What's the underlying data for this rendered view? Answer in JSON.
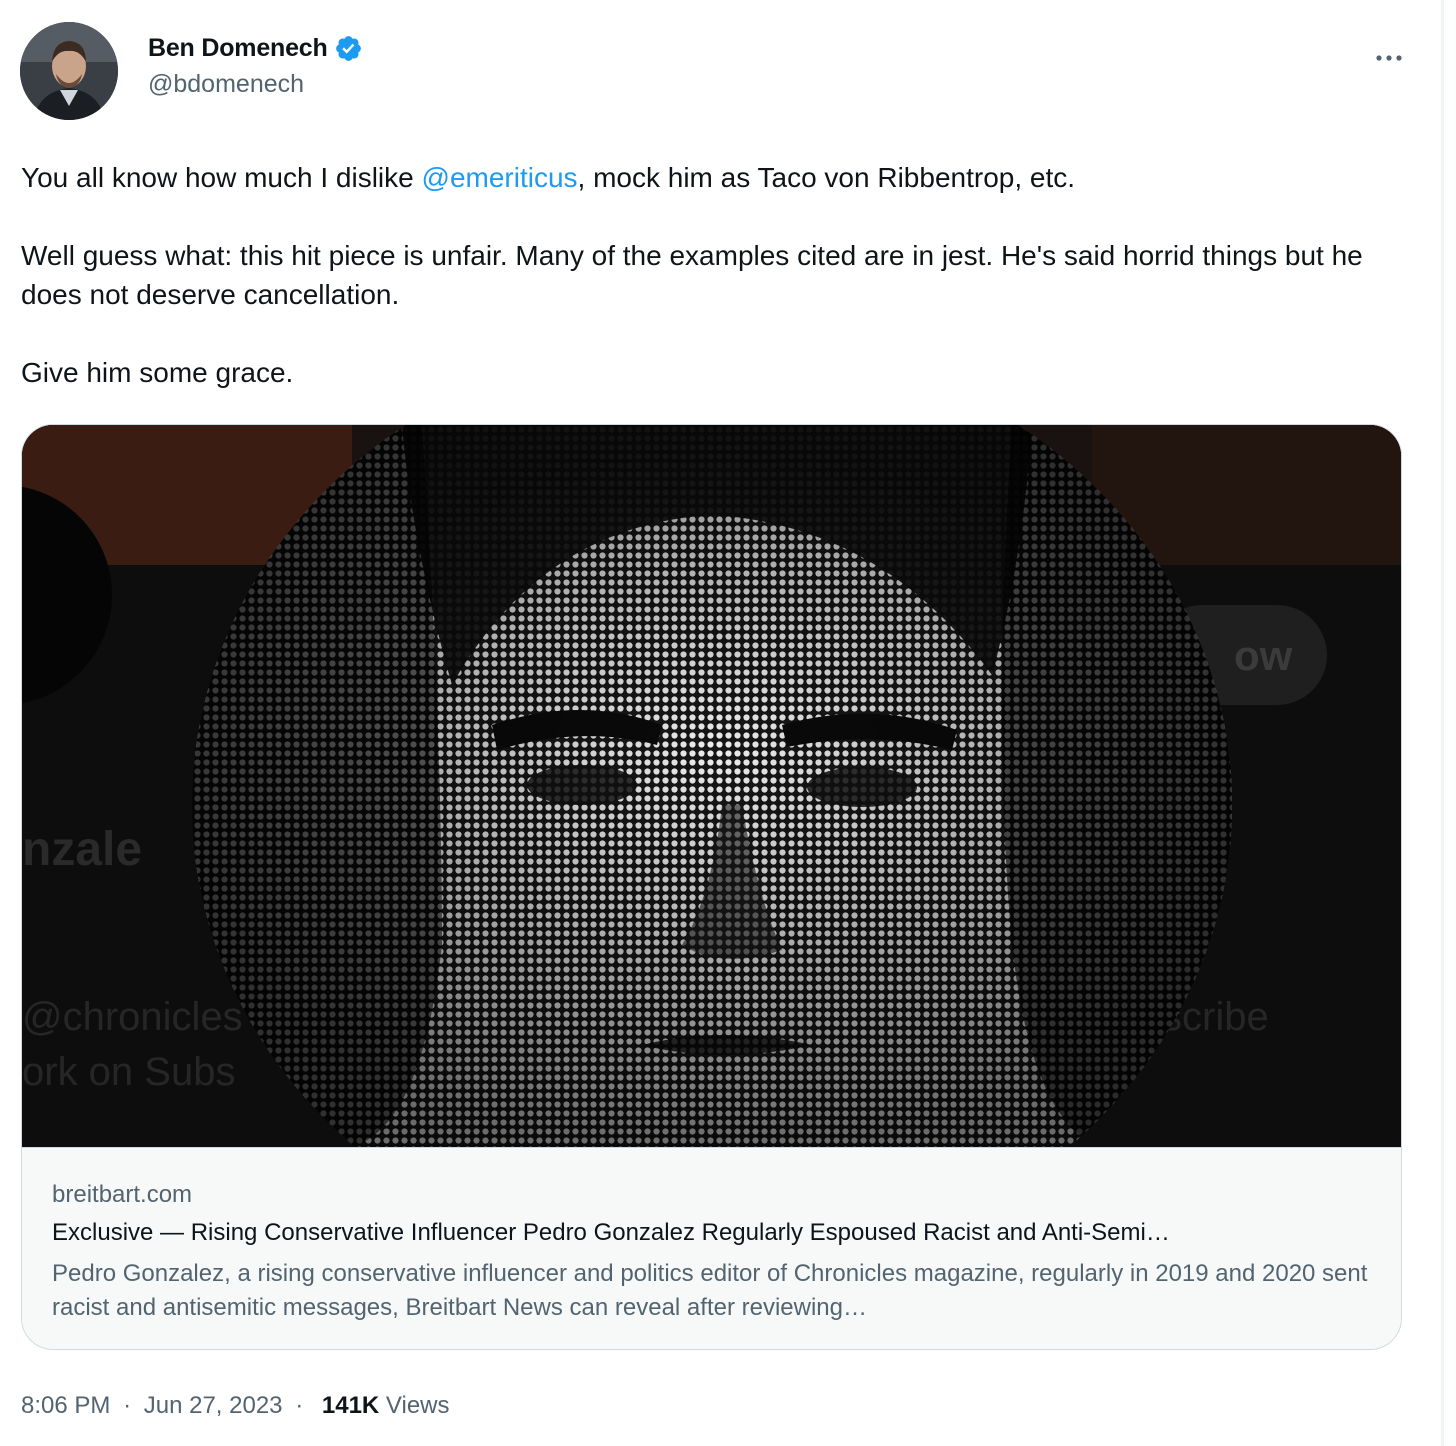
{
  "author": {
    "display_name": "Ben Domenech",
    "handle": "@bdomenech",
    "verified": true,
    "avatar_icon": "avatar-photo"
  },
  "menu": {
    "icon": "more-icon"
  },
  "tweet": {
    "line1_before": "You all know how much I dislike ",
    "mention": "@emeriticus",
    "line1_after": ", mock him as Taco von Ribbentrop, etc.",
    "paragraph2": "Well guess what: this hit piece is unfair. Many of the examples cited are in jest. He's said horrid things but he does not deserve cancellation.",
    "paragraph3": "Give him some grace."
  },
  "card": {
    "image_texts": {
      "name_fragment": "nzale",
      "handle_fragment": "@chronicles",
      "work_fragment": "ork on Subs",
      "follow_fragment": "ow",
      "subscribe_fragment": "scribe"
    },
    "domain": "breitbart.com",
    "title": "Exclusive — Rising Conservative Influencer Pedro Gonzalez Regularly Espoused Racist and Anti-Semi…",
    "description": "Pedro Gonzalez, a rising conservative influencer and politics editor of Chronicles magazine, regularly in 2019 and 2020 sent racist and antisemitic messages, Breitbart News can reveal after reviewing…"
  },
  "meta": {
    "time": "8:06 PM",
    "date": "Jun 27, 2023",
    "separator": "·",
    "views_count": "141K",
    "views_label": "Views"
  },
  "colors": {
    "link": "#1d9bf0",
    "verified": "#1d9bf0",
    "secondary_text": "#536471",
    "primary_text": "#0f1419"
  }
}
